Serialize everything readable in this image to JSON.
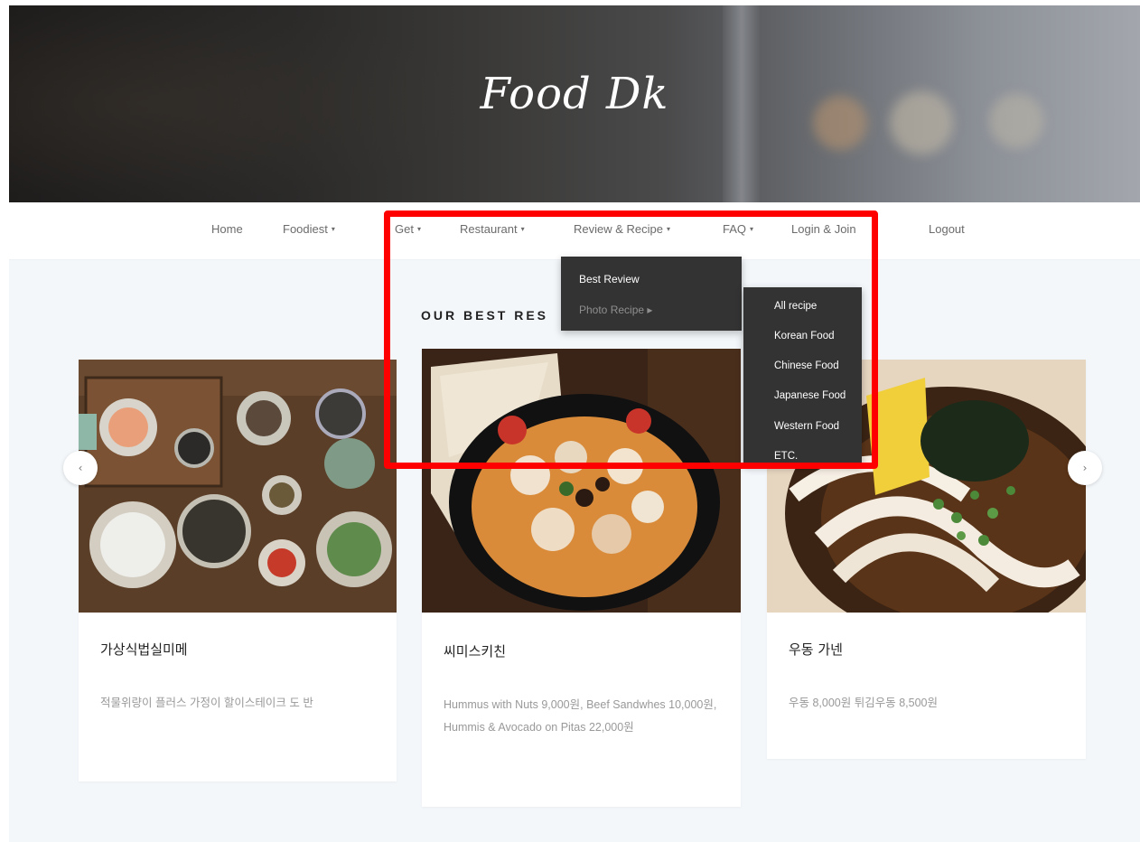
{
  "hero": {
    "logo": "Food Dk"
  },
  "nav": {
    "items": [
      {
        "label": "Home",
        "has_caret": false
      },
      {
        "label": "Foodiest",
        "has_caret": true
      },
      {
        "label": "Get",
        "has_caret": true
      },
      {
        "label": "Restaurant",
        "has_caret": true
      },
      {
        "label": "Review & Recipe",
        "has_caret": true
      },
      {
        "label": "FAQ",
        "has_caret": true
      },
      {
        "label": "Login & Join",
        "has_caret": false
      },
      {
        "label": "Logout",
        "has_caret": false
      }
    ],
    "caret": "▾"
  },
  "section": {
    "title": "OUR BEST RES"
  },
  "dropdown": {
    "items": [
      "Best Review",
      "Photo Recipe ▸"
    ],
    "submenu": [
      "All recipe",
      "Korean Food",
      "Chinese Food",
      "Japanese Food",
      "Western Food",
      "ETC."
    ]
  },
  "cards": [
    {
      "title": "가상식법실미메",
      "desc": "적물위량이 플러스 가정이 할이스테이크 도 반"
    },
    {
      "title": "씨미스키친",
      "desc": "Hummus with Nuts 9,000원, Beef Sandwhes 10,000원, Hummis & Avocado on Pitas 22,000원"
    },
    {
      "title": "우동 가넨",
      "desc": "우동 8,000원 튀김우동 8,500원"
    }
  ],
  "arrows": {
    "prev": "‹",
    "next": "›"
  },
  "colors": {
    "dropdown_bg": "#333333",
    "highlight": "#ff0000",
    "page_bg": "#f3f7fa"
  }
}
